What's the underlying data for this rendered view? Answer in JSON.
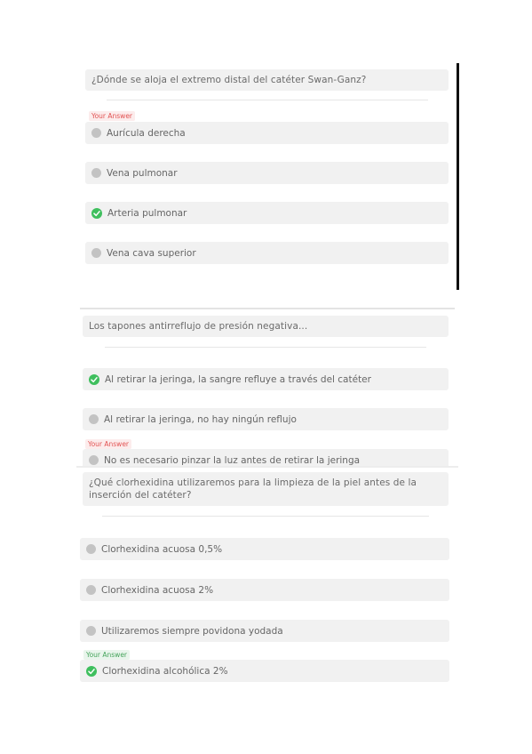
{
  "q1": {
    "question": "¿Dónde se aloja el extremo distal del catéter Swan-Ganz?",
    "your_answer_tag": "Your Answer",
    "options": [
      "Aurícula derecha",
      "Vena pulmonar",
      "Arteria pulmonar",
      "Vena cava superior"
    ]
  },
  "q2": {
    "question": "Los tapones antirreflujo de presión negativa...",
    "your_answer_tag": "Your Answer",
    "options": [
      "Al retirar la jeringa, la sangre refluye a través del catéter",
      "Al retirar la jeringa, no hay ningún reflujo",
      "No es necesario pinzar la luz antes de retirar la jeringa"
    ]
  },
  "q3": {
    "question": "¿Qué clorhexidina utilizaremos para la limpieza de la piel antes de la inserción del catéter?",
    "your_answer_tag": "Your Answer",
    "options": [
      "Clorhexidina acuosa 0,5%",
      "Clorhexidina acuosa 2%",
      "Utilizaremos siempre povidona yodada",
      "Clorhexidina alcohólica 2%"
    ]
  },
  "colors": {
    "correct": "#3fbf5e",
    "wrong_tag": "#e25353",
    "correct_tag": "#45a45b"
  }
}
